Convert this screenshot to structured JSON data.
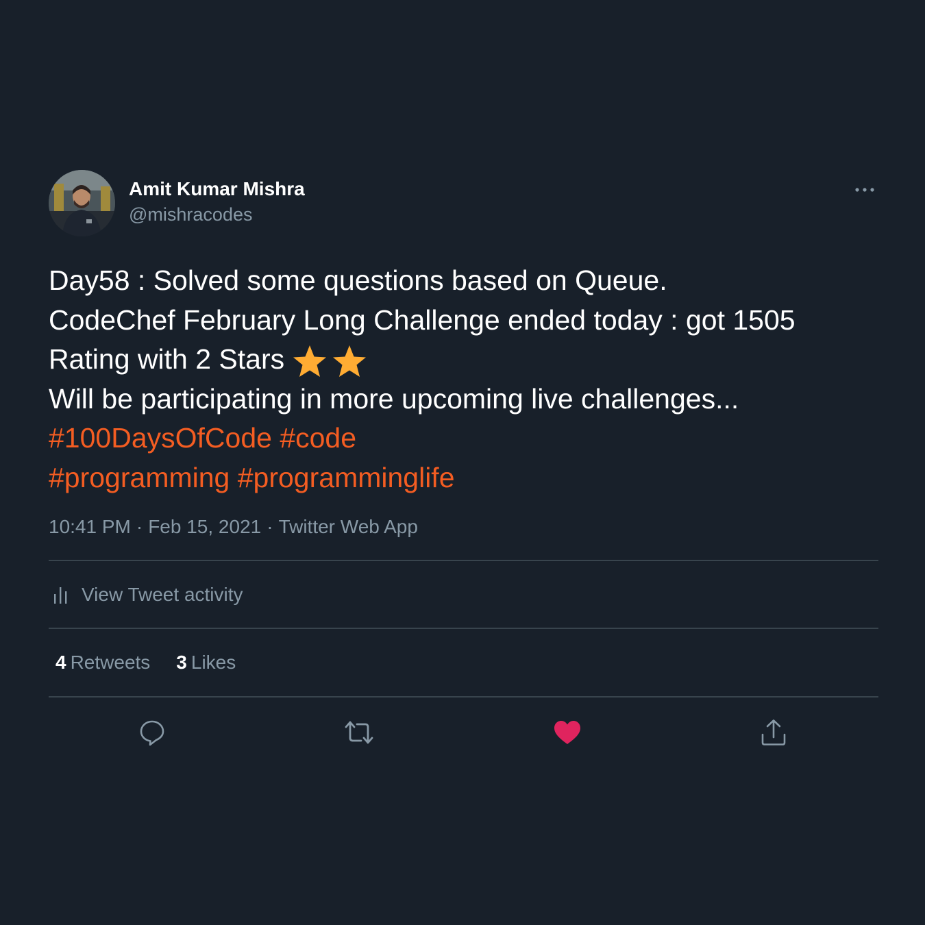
{
  "author": {
    "display_name": "Amit Kumar Mishra",
    "handle": "@mishracodes"
  },
  "tweet": {
    "line1": "Day58 : Solved some questions based on Queue.",
    "line2": "CodeChef February Long Challenge ended today : got 1505",
    "line3": "Rating with 2 Stars",
    "line3_emoji": "star-icon x2",
    "line4": "Will be participating in more upcoming live challenges...",
    "hashtags": {
      "tag1": "#100DaysOfCode",
      "tag2": "#code",
      "tag3": "#programming",
      "tag4": "#programminglife"
    }
  },
  "meta": {
    "time": "10:41 PM",
    "date": "Feb 15, 2021",
    "separator": "·",
    "source": "Twitter Web App"
  },
  "activity": {
    "label": "View Tweet activity"
  },
  "stats": {
    "retweets_count": "4",
    "retweets_label": "Retweets",
    "likes_count": "3",
    "likes_label": "Likes"
  },
  "actions": {
    "reply_icon": "reply-icon",
    "retweet_icon": "retweet-icon",
    "like_icon": "heart-icon",
    "share_icon": "share-icon",
    "liked": true
  },
  "colors": {
    "background": "#18202a",
    "text": "#ffffff",
    "secondary_text": "#8899a6",
    "hashtag": "#f45d22",
    "divider": "#38444d",
    "like": "#e0245e",
    "star": "#ffac33"
  }
}
